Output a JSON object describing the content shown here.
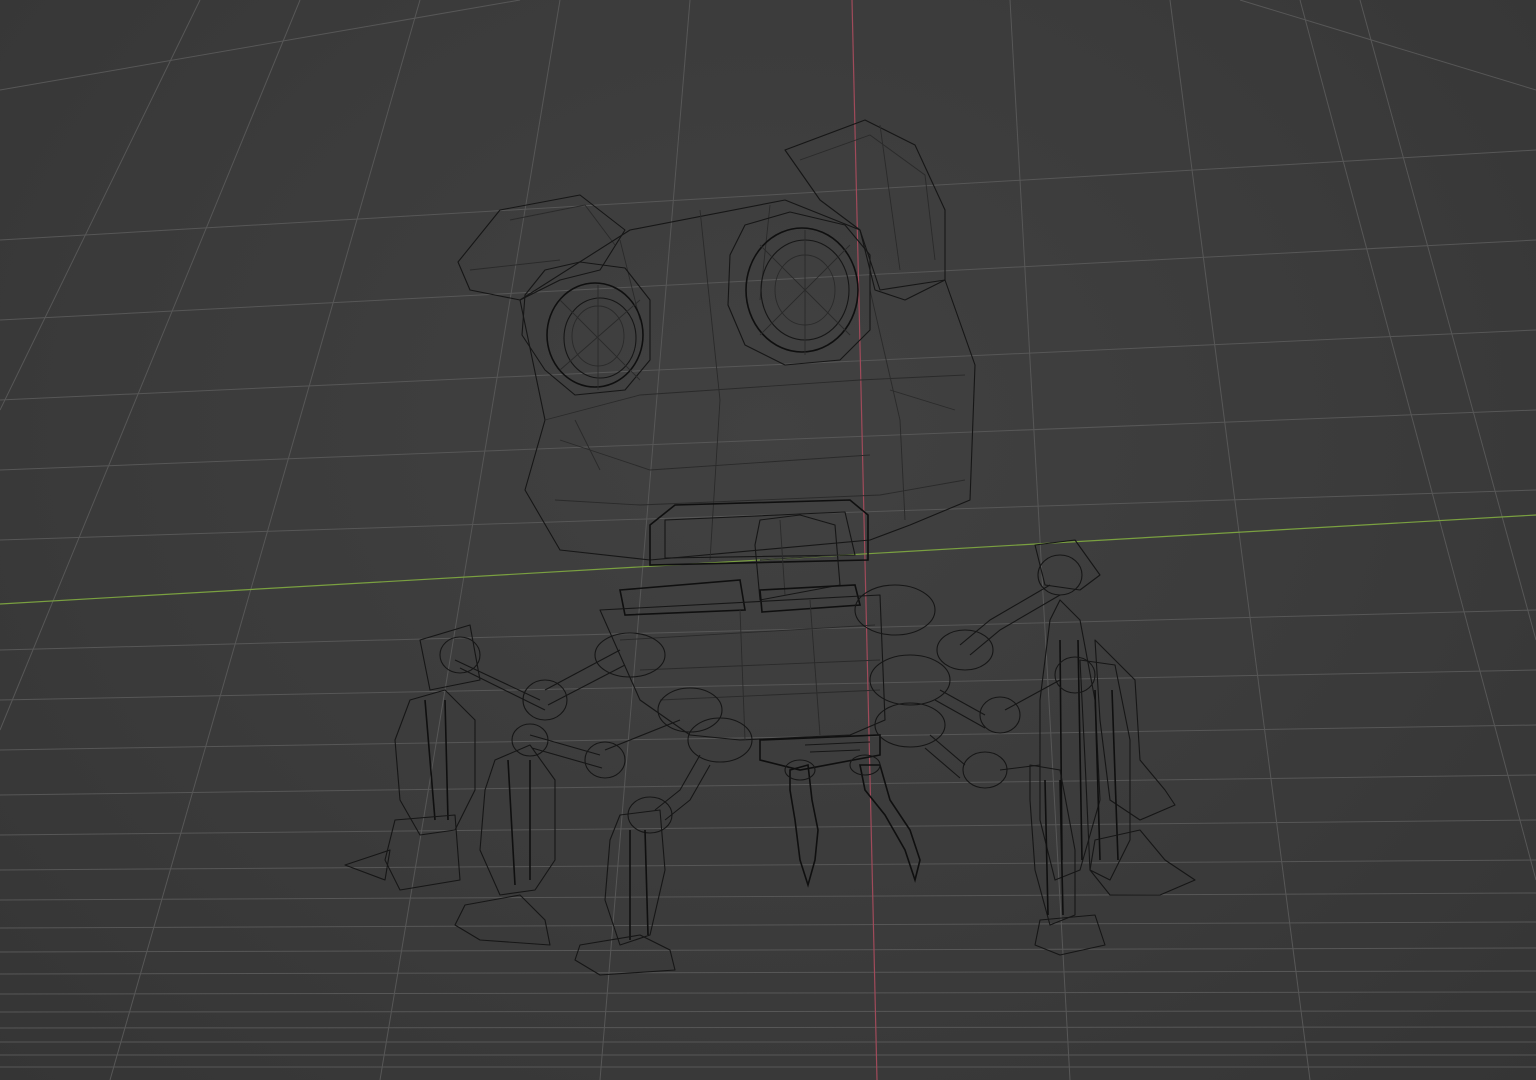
{
  "viewport": {
    "mode": "wireframe",
    "background": "#3a3a3a",
    "grid_color": "#575757",
    "x_axis_color": "#a04a5a",
    "y_axis_color": "#7aa040",
    "wire_color": "#161616"
  },
  "model": {
    "icon": "robot-frog-wireframe"
  }
}
